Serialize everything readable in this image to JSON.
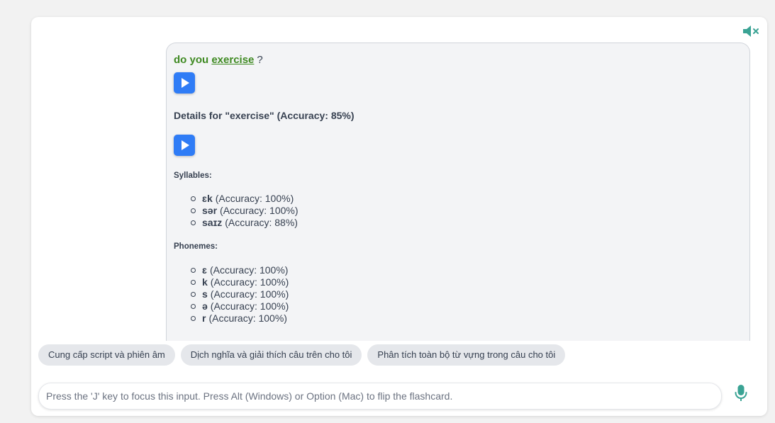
{
  "sentence": {
    "prefix": "do you",
    "word": "exercise",
    "suffix": "?"
  },
  "details": {
    "title": "Details for \"exercise\" (Accuracy: 85%)"
  },
  "syllables": {
    "title": "Syllables:",
    "items": [
      {
        "symbol": "ɛk",
        "accuracy": "(Accuracy: 100%)"
      },
      {
        "symbol": "sər",
        "accuracy": "(Accuracy: 100%)"
      },
      {
        "symbol": "saɪz",
        "accuracy": "(Accuracy: 88%)"
      }
    ]
  },
  "phonemes": {
    "title": "Phonemes:",
    "items": [
      {
        "symbol": "ɛ",
        "accuracy": "(Accuracy: 100%)"
      },
      {
        "symbol": "k",
        "accuracy": "(Accuracy: 100%)"
      },
      {
        "symbol": "s",
        "accuracy": "(Accuracy: 100%)"
      },
      {
        "symbol": "ə",
        "accuracy": "(Accuracy: 100%)"
      },
      {
        "symbol": "r",
        "accuracy": "(Accuracy: 100%)"
      }
    ]
  },
  "suggestions": [
    "Cung cấp script và phiên âm",
    "Dịch nghĩa và giải thích câu trên cho tôi",
    "Phân tích toàn bộ từ vựng trong câu cho tôi"
  ],
  "input": {
    "placeholder": "Press the 'J' key to focus this input. Press Alt (Windows) or Option (Mac) to flip the flashcard."
  },
  "icons": {
    "mute": "speaker-muted-icon",
    "play": "play-icon",
    "mic": "microphone-icon"
  },
  "colors": {
    "accent": "#2f7cf6",
    "word": "#3f8a22",
    "icon_teal": "#3aa394"
  }
}
